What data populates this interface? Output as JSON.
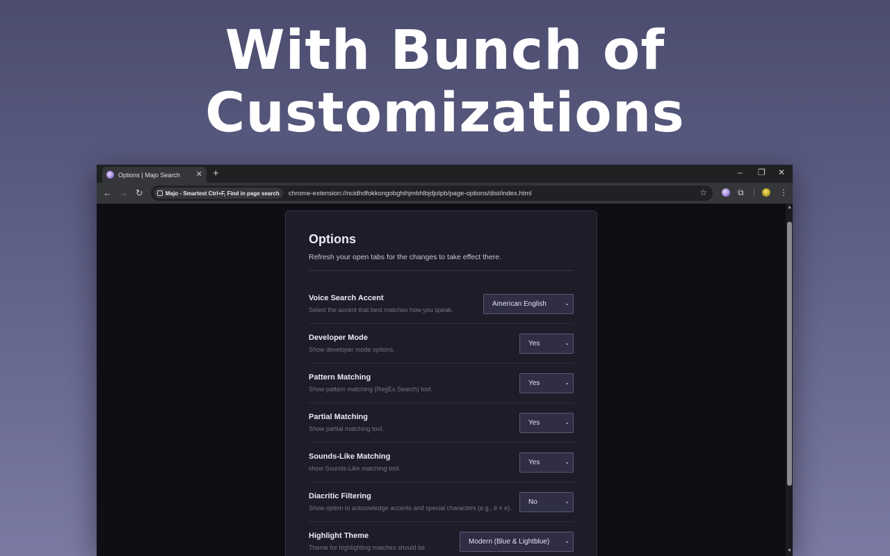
{
  "headline": "With Bunch of Customizations",
  "browser": {
    "tab_title": "Options | Majo Search",
    "new_tab": "+",
    "chip_label": "Majo - Smartest Ctrl+F, Find in page search",
    "url": "chrome-extension://ncidhdfokkongobghihjmbhlbjdjolpb/page-options/dist/index.html"
  },
  "options": {
    "title": "Options",
    "subtitle": "Refresh your open tabs for the changes to take effect there.",
    "rows": [
      {
        "label": "Voice Search Accent",
        "desc": "Select the accent that best matches how you speak.",
        "value": "American English"
      },
      {
        "label": "Developer Mode",
        "desc": "Show developer mode options.",
        "value": "Yes"
      },
      {
        "label": "Pattern Matching",
        "desc": "Show pattern matching (RegEx Search) tool.",
        "value": "Yes"
      },
      {
        "label": "Partial Matching",
        "desc": "Show partial matching tool.",
        "value": "Yes"
      },
      {
        "label": "Sounds-Like Matching",
        "desc": "show Sounds-Like matching tool.",
        "value": "Yes"
      },
      {
        "label": "Diacritic Filtering",
        "desc": "Show option to acknowledge accents and special characters (e.g., é ≠ e).",
        "value": "No"
      },
      {
        "label": "Highlight Theme",
        "desc": "Theme for highlighting matches should be",
        "value": "Modern (Blue & Lightblue)"
      }
    ]
  },
  "colors": {
    "background_top": "#4b4c6e",
    "background_bottom": "#7a7aa3",
    "card": "#1d1c28",
    "select": "#2f2e44"
  }
}
